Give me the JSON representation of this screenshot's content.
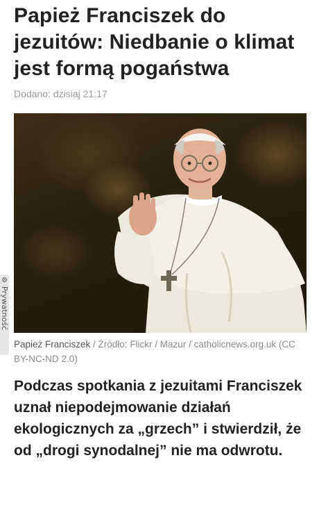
{
  "article": {
    "title": "Papież Franciszek do jezuitów: Niedbanie o klimat jest formą pogaństwa",
    "added": "Dodano: dzisiaj 21:17",
    "image_alt": "Papież Franciszek machający ręką",
    "caption_main": "Papież Franciszek",
    "caption_source": " / Źródło: Flickr / Mazur / catholicnews.org.uk (CC BY-NC-ND 2.0)",
    "lead": "Podczas spotkania z jezuitami Franciszek uznał niepodejmowanie działań ekologicznych za „grzech” i stwierdził, że od „drogi synodalnej” nie ma odwrotu."
  },
  "privacy": {
    "label": "Prywatność",
    "icon": "gear-icon"
  }
}
